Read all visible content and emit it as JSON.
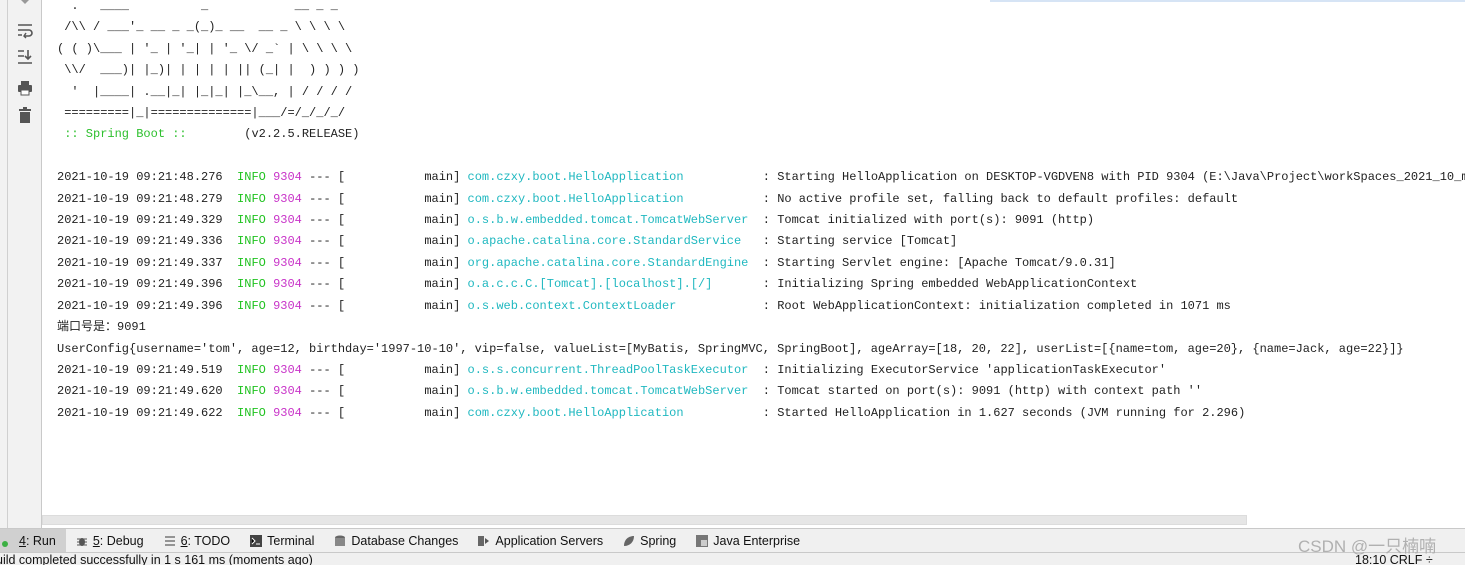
{
  "toolbar": {
    "icons": [
      "settings-icon",
      "soft-wrap-icon",
      "scroll-to-end-icon",
      "print-icon",
      "trash-icon"
    ]
  },
  "banner": {
    "lines": [
      "  .   ____          _            __ _ _",
      " /\\\\ / ___'_ __ _ _(_)_ __  __ _ \\ \\ \\ \\",
      "( ( )\\___ | '_ | '_| | '_ \\/ _` | \\ \\ \\ \\",
      " \\\\/  ___)| |_)| | | | | || (_| |  ) ) ) )",
      "  '  |____| .__|_| |_|_| |_\\__, | / / / /",
      " =========|_|==============|___/=/_/_/_/"
    ],
    "spring_boot_label": " :: Spring Boot :: ",
    "version": "       (v2.2.5.RELEASE)"
  },
  "log": [
    {
      "ts": "2021-10-19 09:21:48.276",
      "level": "INFO",
      "pid": "9304",
      "thread": "main",
      "logger": "com.czxy.boot.HelloApplication",
      "msg": "Starting HelloApplication on DESKTOP-VGDVEN8 with PID 9304 (E:\\Java\\Project\\workSpaces_2021_10_m"
    },
    {
      "ts": "2021-10-19 09:21:48.279",
      "level": "INFO",
      "pid": "9304",
      "thread": "main",
      "logger": "com.czxy.boot.HelloApplication",
      "msg": "No active profile set, falling back to default profiles: default"
    },
    {
      "ts": "2021-10-19 09:21:49.329",
      "level": "INFO",
      "pid": "9304",
      "thread": "main",
      "logger": "o.s.b.w.embedded.tomcat.TomcatWebServer",
      "msg": "Tomcat initialized with port(s): 9091 (http)"
    },
    {
      "ts": "2021-10-19 09:21:49.336",
      "level": "INFO",
      "pid": "9304",
      "thread": "main",
      "logger": "o.apache.catalina.core.StandardService",
      "msg": "Starting service [Tomcat]"
    },
    {
      "ts": "2021-10-19 09:21:49.337",
      "level": "INFO",
      "pid": "9304",
      "thread": "main",
      "logger": "org.apache.catalina.core.StandardEngine",
      "msg": "Starting Servlet engine: [Apache Tomcat/9.0.31]"
    },
    {
      "ts": "2021-10-19 09:21:49.396",
      "level": "INFO",
      "pid": "9304",
      "thread": "main",
      "logger": "o.a.c.c.C.[Tomcat].[localhost].[/]",
      "msg": "Initializing Spring embedded WebApplicationContext"
    },
    {
      "ts": "2021-10-19 09:21:49.396",
      "level": "INFO",
      "pid": "9304",
      "thread": "main",
      "logger": "o.s.web.context.ContextLoader",
      "msg": "Root WebApplicationContext: initialization completed in 1071 ms"
    },
    {
      "plain": "端口号是：9091"
    },
    {
      "plain": "UserConfig{username='tom', age=12, birthday='1997-10-10', vip=false, valueList=[MyBatis, SpringMVC, SpringBoot], ageArray=[18, 20, 22], userList=[{name=tom, age=20}, {name=Jack, age=22}]}"
    },
    {
      "ts": "2021-10-19 09:21:49.519",
      "level": "INFO",
      "pid": "9304",
      "thread": "main",
      "logger": "o.s.s.concurrent.ThreadPoolTaskExecutor",
      "msg": "Initializing ExecutorService 'applicationTaskExecutor'"
    },
    {
      "ts": "2021-10-19 09:21:49.620",
      "level": "INFO",
      "pid": "9304",
      "thread": "main",
      "logger": "o.s.b.w.embedded.tomcat.TomcatWebServer",
      "msg": "Tomcat started on port(s): 9091 (http) with context path ''"
    },
    {
      "ts": "2021-10-19 09:21:49.622",
      "level": "INFO",
      "pid": "9304",
      "thread": "main",
      "logger": "com.czxy.boot.HelloApplication",
      "msg": "Started HelloApplication in 1.627 seconds (JVM running for 2.296)"
    }
  ],
  "tabs": [
    {
      "key": "4",
      "label": ": Run",
      "icon": "run-icon",
      "active": true
    },
    {
      "key": "5",
      "label": ": Debug",
      "icon": "bug-icon"
    },
    {
      "key": "6",
      "label": ": TODO",
      "icon": "list-icon"
    },
    {
      "key": "",
      "label": "Terminal",
      "icon": "terminal-icon"
    },
    {
      "key": "",
      "label": "Database Changes",
      "icon": "database-icon"
    },
    {
      "key": "",
      "label": "Application Servers",
      "icon": "server-icon"
    },
    {
      "key": "",
      "label": "Spring",
      "icon": "spring-leaf-icon"
    },
    {
      "key": "",
      "label": "Java Enterprise",
      "icon": "java-enterprise-icon"
    }
  ],
  "status": {
    "message": "uild completed successfully in 1 s 161 ms (moments ago)",
    "right": "18:10   CRLF ÷"
  },
  "watermark": "CSDN @一只楠喃",
  "colors": {
    "info": "#1fc21f",
    "pid": "#c832c8",
    "logger": "#20b8c0",
    "spring": "#2ec02e"
  }
}
